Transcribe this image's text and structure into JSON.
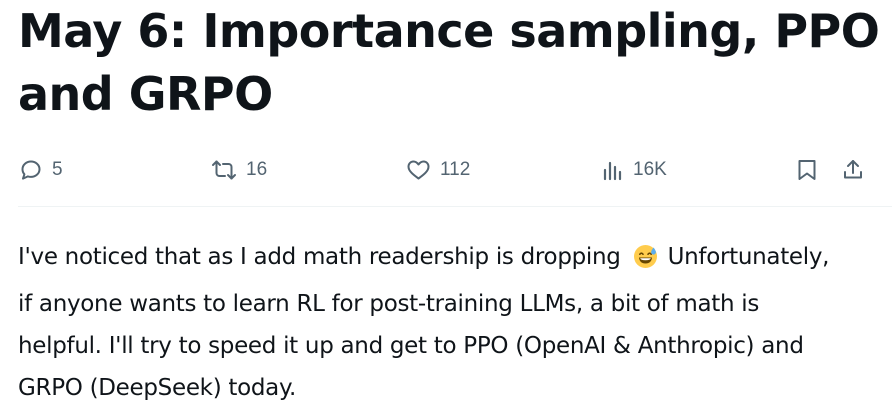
{
  "post": {
    "title": "May 6: Importance sampling, PPO and GRPO",
    "body_lines": [
      {
        "before_emoji": "I've noticed that as I add math readership is dropping",
        "after_emoji": "Unfortunately,"
      },
      {
        "text": "if anyone wants to learn RL for post-training  LLMs, a bit of math is"
      },
      {
        "text": "helpful. I'll try to speed it up and get to PPO (OpenAI & Anthropic) and"
      },
      {
        "text": "GRPO (DeepSeek)  today."
      }
    ],
    "emoji": "grinning-face-with-sweat"
  },
  "actions": {
    "reply": {
      "icon": "reply-icon",
      "count": "5"
    },
    "repost": {
      "icon": "repost-icon",
      "count": "16"
    },
    "like": {
      "icon": "heart-icon",
      "count": "112"
    },
    "views": {
      "icon": "views-icon",
      "count": "16K"
    },
    "bookmark": {
      "icon": "bookmark-icon"
    },
    "share": {
      "icon": "share-icon"
    }
  },
  "colors": {
    "text": "#0f1419",
    "muted": "#536471",
    "divider": "#eff3f4",
    "emoji_face": "#ffcc4d"
  }
}
